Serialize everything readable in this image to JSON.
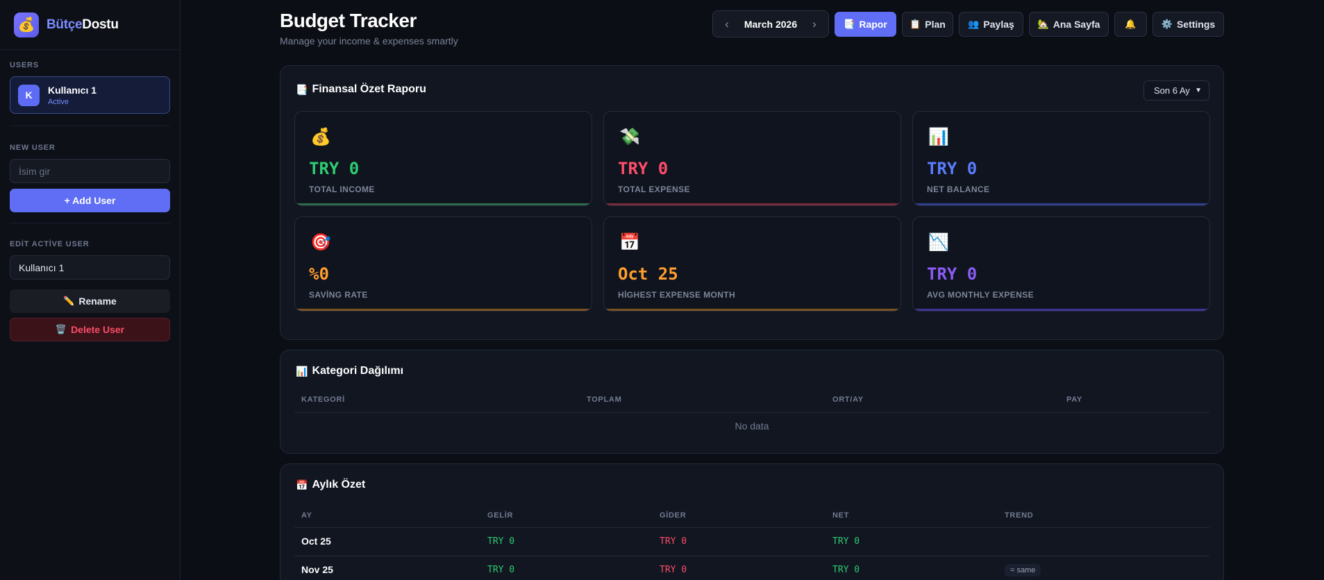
{
  "brand": {
    "icon": "money-bag-icon",
    "name_a": "Bütçe",
    "name_b": "Dostu"
  },
  "sidebar": {
    "users_label": "USERS",
    "active_user": {
      "initial": "K",
      "name": "Kullanıcı 1",
      "status": "Active"
    },
    "new_user_label": "NEW USER",
    "new_user_placeholder": "İsim gir",
    "add_user_label": "+ Add User",
    "edit_user_label": "EDİT ACTİVE USER",
    "edit_user_value": "Kullanıcı 1",
    "rename_label": "Rename",
    "delete_label": "Delete User"
  },
  "header": {
    "title": "Budget Tracker",
    "subtitle": "Manage your income & expenses smartly",
    "month": "March 2026",
    "buttons": {
      "rapor": "Rapor",
      "plan": "Plan",
      "paylas": "Paylaş",
      "ana_sayfa": "Ana Sayfa",
      "settings": "Settings"
    }
  },
  "summary": {
    "title": "Finansal Özet Raporu",
    "period": "Son 6 Ay",
    "stats": [
      {
        "icon": "money-bag-icon",
        "value": "TRY 0",
        "label": "TOTAL INCOME",
        "color": "#2ecc71",
        "bar": "#2d6b4a"
      },
      {
        "icon": "money-wings-icon",
        "value": "TRY 0",
        "label": "TOTAL EXPENSE",
        "color": "#ff4d6a",
        "bar": "#7a2a3a"
      },
      {
        "icon": "bar-chart-icon",
        "value": "TRY 0",
        "label": "NET BALANCE",
        "color": "#5c7cff",
        "bar": "#2f3f8c"
      },
      {
        "icon": "target-icon",
        "value": "%0",
        "label": "SAVİNG RATE",
        "color": "#ff9f2e",
        "bar": "#7a5320"
      },
      {
        "icon": "calendar-icon",
        "value": "Oct 25",
        "label": "HİGHEST EXPENSE MONTH",
        "color": "#ff9f2e",
        "bar": "#7a5320"
      },
      {
        "icon": "chart-decreasing-icon",
        "value": "TRY 0",
        "label": "AVG MONTHLY EXPENSE",
        "color": "#8b5cf6",
        "bar": "#3e3596"
      }
    ]
  },
  "categories": {
    "title": "Kategori Dağılımı",
    "columns": [
      "KATEGORİ",
      "TOPLAM",
      "ORT/AY",
      "PAY"
    ],
    "empty": "No data"
  },
  "monthly": {
    "title": "Aylık Özet",
    "columns": [
      "AY",
      "GELİR",
      "GİDER",
      "NET",
      "TREND"
    ],
    "rows": [
      {
        "month": "Oct 25",
        "income": "TRY 0",
        "expense": "TRY 0",
        "net": "TRY 0",
        "trend": ""
      },
      {
        "month": "Nov 25",
        "income": "TRY 0",
        "expense": "TRY 0",
        "net": "TRY 0",
        "trend": "= same"
      }
    ]
  },
  "colors": {
    "accent": "#5f6ef5",
    "income": "#2ecc71",
    "expense": "#ff4d6a"
  }
}
